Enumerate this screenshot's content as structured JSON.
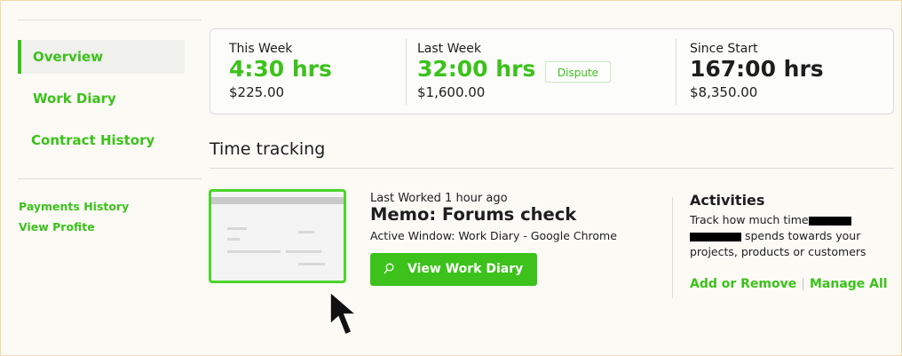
{
  "sidebar": {
    "items": [
      {
        "label": "Overview",
        "active": true
      },
      {
        "label": "Work Diary"
      },
      {
        "label": "Contract History"
      }
    ],
    "links": [
      {
        "label": "Payments History"
      },
      {
        "label": "View Profite"
      }
    ]
  },
  "stats": {
    "this_week": {
      "label": "This Week",
      "hours": "4:30 hrs",
      "amount": "$225.00"
    },
    "last_week": {
      "label": "Last Week",
      "hours": "32:00 hrs",
      "amount": "$1,600.00",
      "dispute_label": "Dispute"
    },
    "since_start": {
      "label": "Since Start",
      "hours": "167:00 hrs",
      "amount": "$8,350.00"
    }
  },
  "time_tracking": {
    "title": "Time tracking",
    "last_worked": "Last Worked 1 hour ago",
    "memo": "Memo: Forums check",
    "active_window": "Active Window: Work Diary - Google Chrome",
    "view_button_label": "View Work Diary",
    "view_button_icon": "search-icon"
  },
  "activities": {
    "title": "Activities",
    "desc_part1": "Track how much time",
    "desc_part2": "spends towards your projects, products or customers",
    "add_remove_label": "Add or Remove",
    "separator": "|",
    "manage_all_label": "Manage All"
  },
  "colors": {
    "accent": "#3cc21b",
    "background": "#fbfaf5",
    "text": "#1e1e1e"
  }
}
